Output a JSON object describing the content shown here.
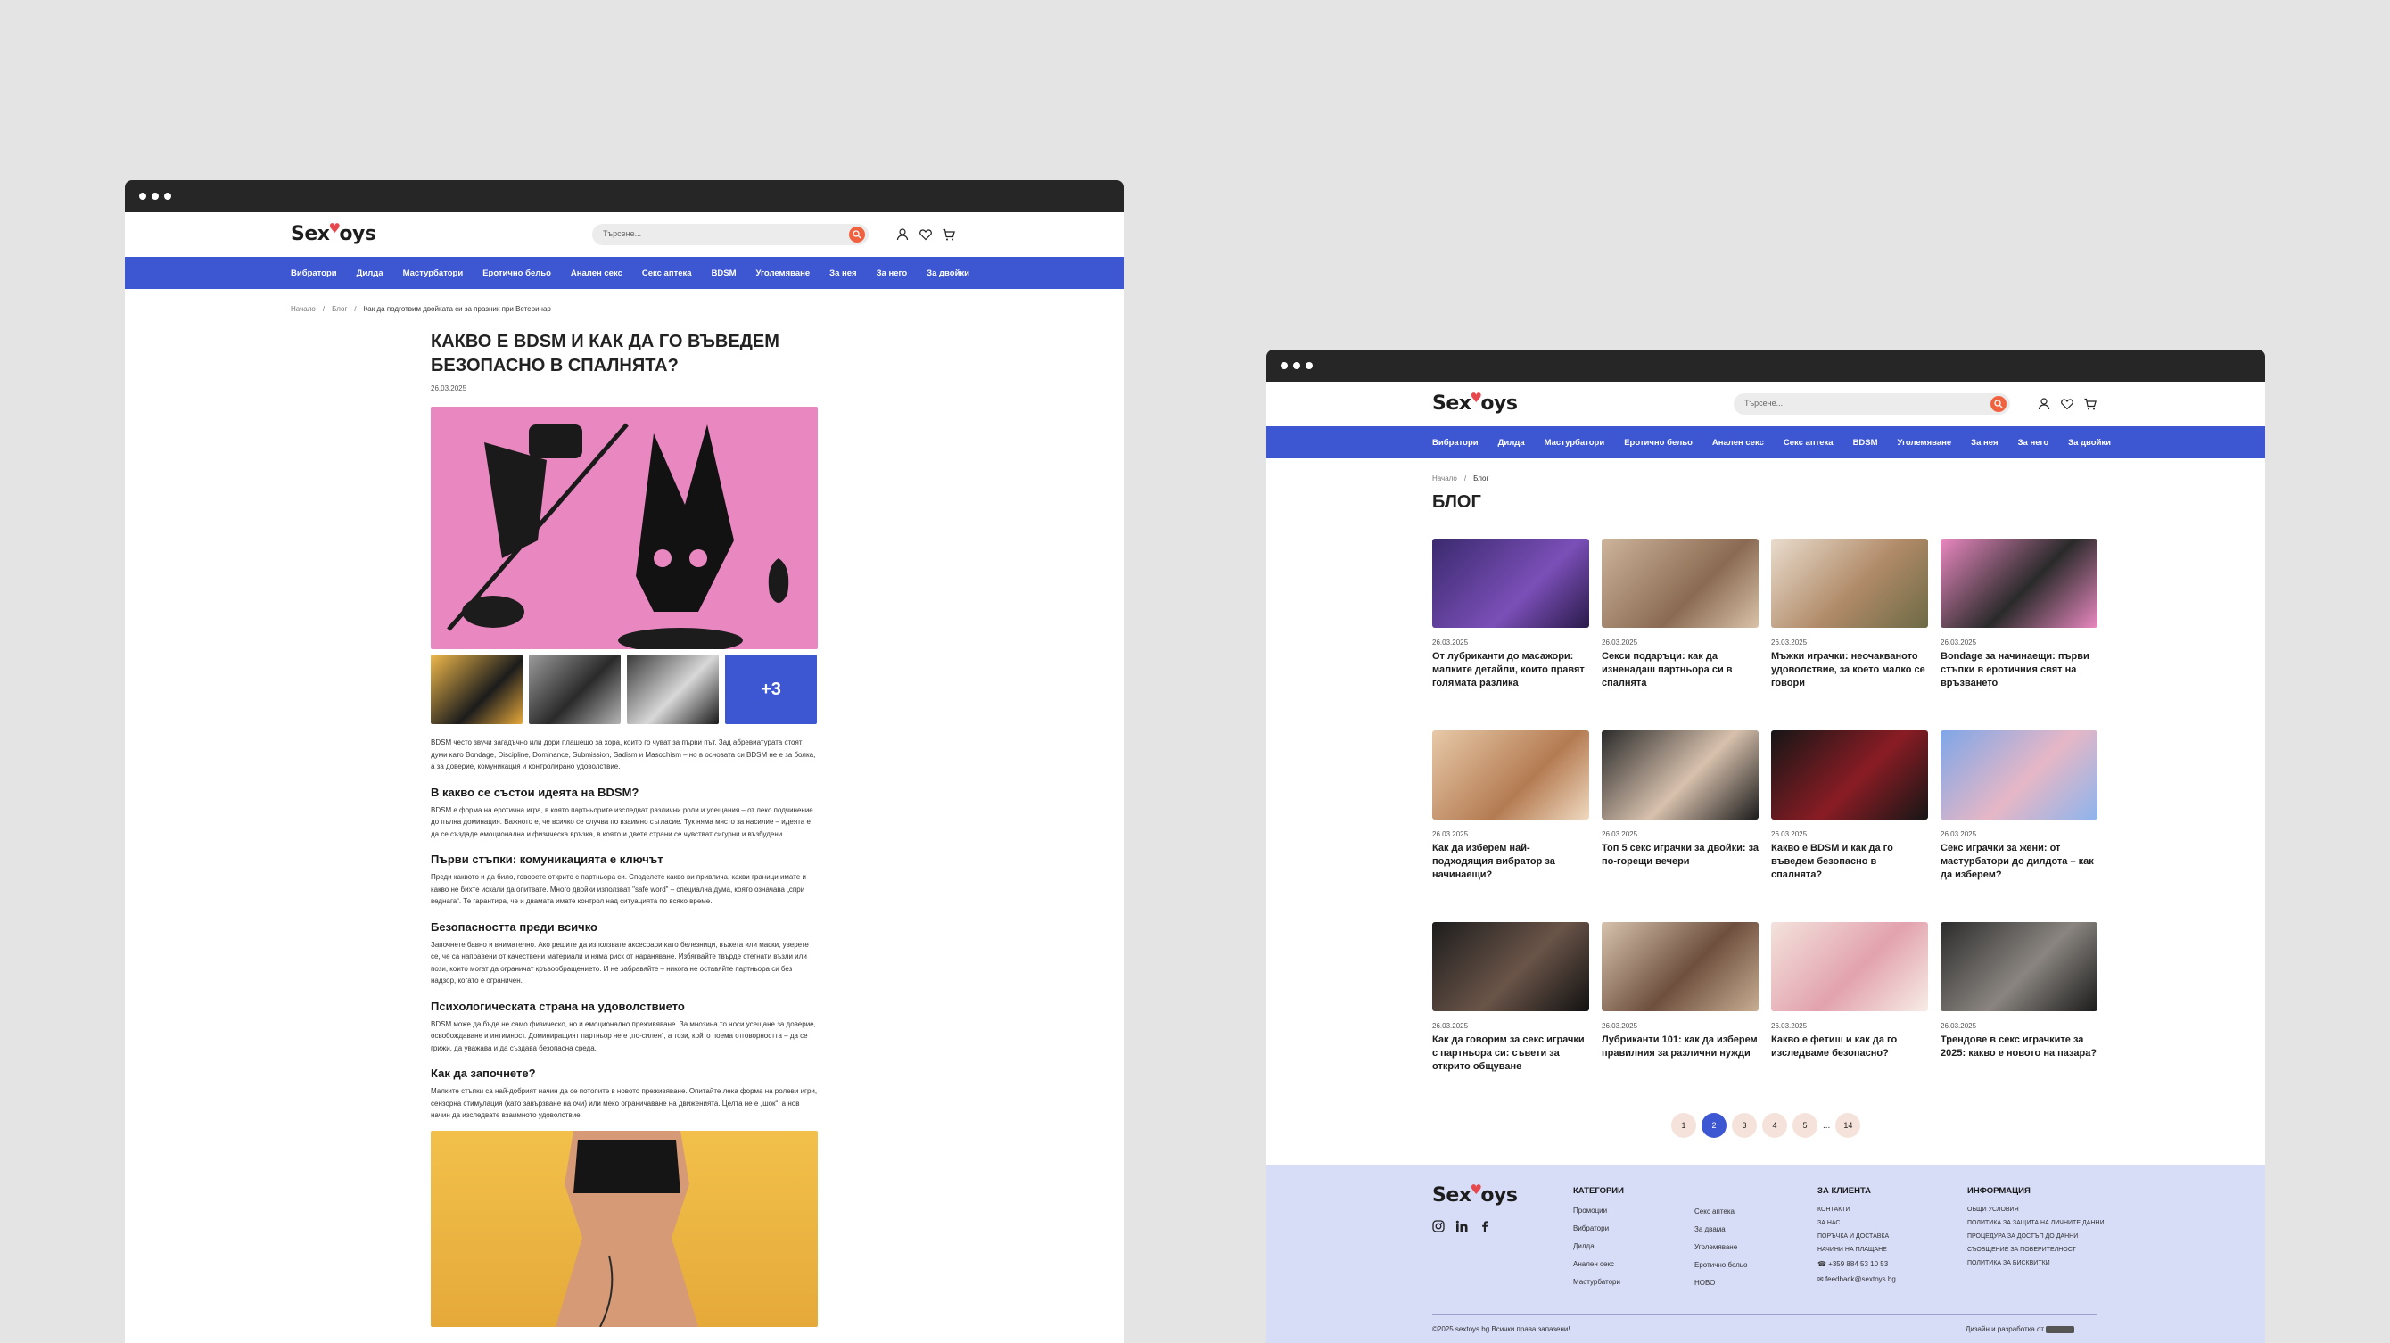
{
  "brand": {
    "name_start": "Sex",
    "name_end": "oys",
    "heart": "♥",
    "accent": "#3d56d1",
    "search_btn": "#f0623f"
  },
  "search": {
    "placeholder": "Търсене..."
  },
  "nav": [
    "Вибратори",
    "Дилда",
    "Мастурбатори",
    "Еротично бельо",
    "Анален секс",
    "Секс аптека",
    "BDSM",
    "Уголемяване",
    "За нея",
    "За него",
    "За двойки"
  ],
  "left": {
    "breadcrumb": [
      "Начало",
      "Блог",
      "Как да подготвим двойката си за празник при Ветеринар"
    ],
    "article": {
      "title": "Какво е BDSM и как да го въведем безопасно в спалнята?",
      "date": "26.03.2025",
      "more_images": "+3",
      "intro": "BDSM често звучи загадъчно или дори плашещо за хора, които го чуват за първи път. Зад абревиатурата стоят думи като Bondage, Discipline, Dominance, Submission, Sadism и Masochism – но в основата си BDSM не е за болка, а за доверие, комуникация и контролирано удоволствие.",
      "sections": [
        {
          "h": "В какво се състои идеята на BDSM?",
          "p": "BDSM е форма на еротична игра, в която партньорите изследват различни роли и усещания – от леко подчинение до пълна доминация. Важното е, че всичко се случва по взаимно съгласие. Тук няма място за насилие – идеята е да се създаде емоционална и физическа връзка, в която и двете страни се чувстват сигурни и възбудени."
        },
        {
          "h": "Първи стъпки: комуникацията е ключът",
          "p": "Преди каквото и да било, говорете открито с партньора си. Споделете какво ви привлича, какви граници имате и какво не бихте искали да опитвате. Много двойки използват \"safe word\" – специална дума, която означава „спри веднага“. Те гарантира, че и двамата имате контрол над ситуацията по всяко време."
        },
        {
          "h": "Безопасността преди всичко",
          "p": "Започнете бавно и внимателно. Ако решите да използвате аксесоари като белезници, въжета или маски, уверете се, че са направени от качествени материали и няма риск от нараняване. Избягвайте твърде стегнати възли или пози, които могат да ограничат кръвообращението. И не забравяйте – никога не оставяйте партньора си без надзор, когато е ограничен."
        },
        {
          "h": "Психологическата страна на удоволствието",
          "p": "BDSM може да бъде не само физическо, но и емоционално преживяване. За мнозина то носи усещане за доверие, освобождаване и интимност. Доминиращият партньор не е „по-силен“, а този, който поема отговорността – да се грижи, да уважава и да създава безопасна среда."
        },
        {
          "h": "Как да започнете?",
          "p": "Малките стъпки са най-добрият начин да се потопите в новото преживяване. Опитайте лека форма на ролеви игри, сензорна стимулация (като завързване на очи) или меко ограничаване на движенията. Целта не е „шок“, а нов начин да изследвате взаимното удоволствие."
        }
      ]
    }
  },
  "right": {
    "breadcrumb": [
      "Начало",
      "Блог"
    ],
    "title": "Блог",
    "posts": [
      {
        "date": "26.03.2025",
        "title": "От лубриканти до масажори: малките детайли, които правят голямата разлика",
        "bg": "linear-gradient(135deg,#3a2a6e,#7b4fb8 60%,#2a1b4a)"
      },
      {
        "date": "26.03.2025",
        "title": "Секси подаръци: как да изненадаш партньора си в спалнята",
        "bg": "linear-gradient(135deg,#cdb49a,#8a6a52 60%,#d9c2a8)"
      },
      {
        "date": "26.03.2025",
        "title": "Мъжки играчки: неочакваното удоволствие, за което малко се говори",
        "bg": "linear-gradient(135deg,#e9dccd,#b08a68 55%,#6d6a45)"
      },
      {
        "date": "26.03.2025",
        "title": "Bondage за начинаещи: първи стъпки в еротичния свят на връзването",
        "bg": "linear-gradient(135deg,#e988c0,#2a2a2a 55%,#e988c0)"
      },
      {
        "date": "26.03.2025",
        "title": "Как да изберем най-подходящия вибратор за начинаещи?",
        "bg": "linear-gradient(135deg,#e7c9a8,#b47b52 60%,#f0d9c0)"
      },
      {
        "date": "26.03.2025",
        "title": "Топ 5 секс играчки за двойки: за по-горещи вечери",
        "bg": "linear-gradient(135deg,#2b2b2b,#d8c1ad 55%,#1c1c1c)"
      },
      {
        "date": "26.03.2025",
        "title": "Какво е BDSM и как да го въведем безопасно в спалнята?",
        "bg": "linear-gradient(135deg,#161616,#8a1c24 55%,#161616)"
      },
      {
        "date": "26.03.2025",
        "title": "Секс играчки за жени: от мастурбатори до дилдота – как да изберем?",
        "bg": "linear-gradient(135deg,#7ea6e8,#e6b7c6 55%,#8db4ec)"
      },
      {
        "date": "26.03.2025",
        "title": "Как да говорим за секс играчки с партньора си: съвети за открито общуване",
        "bg": "linear-gradient(135deg,#1d1d1d,#6a5448 55%,#121212)"
      },
      {
        "date": "26.03.2025",
        "title": "Лубриканти 101: как да изберем правилния за различни нужди",
        "bg": "linear-gradient(135deg,#d6c2ad,#6e4f3e 55%,#c7ad92)"
      },
      {
        "date": "26.03.2025",
        "title": "Какво е фетиш и как да го изследваме безопасно?",
        "bg": "linear-gradient(135deg,#f3e2dc,#e2a2ae 55%,#f7ece6)"
      },
      {
        "date": "26.03.2025",
        "title": "Трендове в секс играчките за 2025: какво е новото на пазара?",
        "bg": "linear-gradient(135deg,#2c2c2c,#8a8580 55%,#1b1b1b)"
      }
    ],
    "pagination": [
      "1",
      "2",
      "3",
      "4",
      "5",
      "...",
      "14"
    ],
    "footer": {
      "cat_title": "Категории",
      "cat_a": [
        "Промоции",
        "Вибратори",
        "Дилда",
        "Анален секс",
        "Мастурбатори"
      ],
      "cat_b": [
        "Секс аптека",
        "За двама",
        "Уголемяване",
        "Еротично бельо",
        "НОВО"
      ],
      "client_title": "За клиента",
      "client": [
        "Контакти",
        "За нас",
        "Поръчка и доставка",
        "Начини на плащане"
      ],
      "phone": "+359 884 53 10 53",
      "email": "feedback@sextoys.bg",
      "info_title": "Информация",
      "info": [
        "Общи условия",
        "Политика за защита на личните данни",
        "Процедура за достъп до данни",
        "Съобщение за поверителност",
        "Политика за бисквитки"
      ],
      "copyright": "©2025 sextoys.bg Всички права запазени!",
      "credit": "Дизайн и разработка от"
    }
  }
}
